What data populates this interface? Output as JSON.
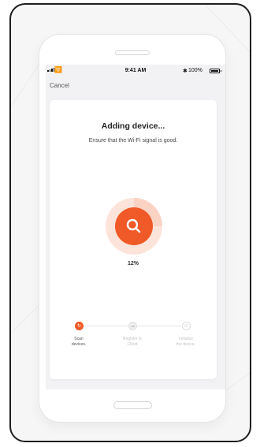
{
  "status_bar": {
    "time": "9:41 AM",
    "battery": "100%",
    "wifi_icon": "wifi-icon",
    "bluetooth_icon": "bluetooth-icon"
  },
  "nav": {
    "cancel_label": "Cancel"
  },
  "dialog": {
    "title": "Adding device...",
    "subtitle": "Ensure that the Wi-Fi signal is good.",
    "progress_percent": 12,
    "progress_label": "12%",
    "progress_icon": "search-icon"
  },
  "steps": [
    {
      "label_line1": "Scan",
      "label_line2": "devices.",
      "state": "active",
      "icon": "spinner-icon"
    },
    {
      "label_line1": "Register to",
      "label_line2": "Cloud",
      "state": "pending",
      "icon": "cloud-icon"
    },
    {
      "label_line1": "Initialize",
      "label_line2": "the device.",
      "state": "pending",
      "icon": "power-icon"
    }
  ],
  "colors": {
    "accent": "#f05a28",
    "accent_light": "#fbd3c4",
    "ring_track": "#fde4da",
    "text_dark": "#222222",
    "text_muted": "#c3c3c3"
  }
}
